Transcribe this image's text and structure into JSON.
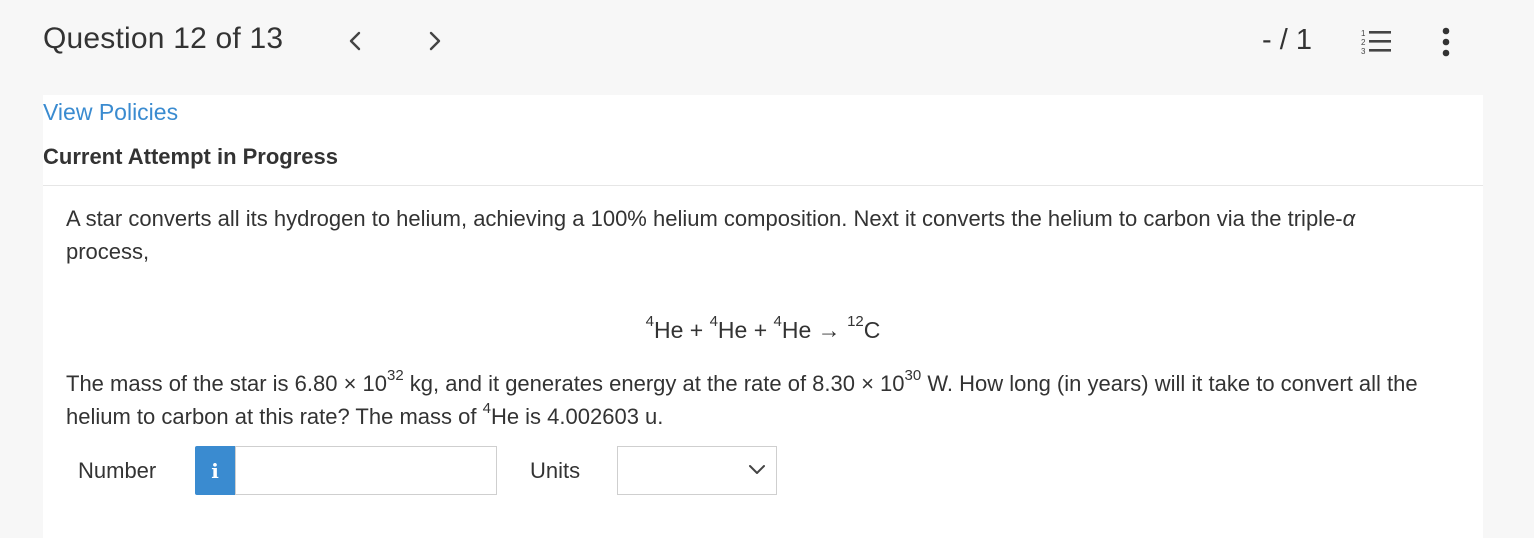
{
  "header": {
    "title": "Question 12 of 13",
    "score": "- / 1",
    "icons": [
      "chevron-left-icon",
      "chevron-right-icon",
      "numbered-list-icon",
      "more-vertical-icon"
    ]
  },
  "links": {
    "view_policies": "View Policies"
  },
  "status": {
    "attempt": "Current Attempt in Progress"
  },
  "question": {
    "p1": "A star converts all its hydrogen to helium, achieving a 100% helium composition. Next it converts the helium to carbon via the triple-",
    "p1_alpha": "α",
    "p1_end": "process,",
    "equation": {
      "he_mass": "4",
      "he": "He",
      "plus": " + ",
      "arrow": " → ",
      "c_mass": "12",
      "c": "C"
    },
    "p2_a": "The mass of the star is 6.80 × 10",
    "p2_exp1": "32",
    "p2_b": " kg, and it generates energy at the rate of 8.30 × 10",
    "p2_exp2": "30",
    "p2_c": " W. How long (in years) will it take to convert all the helium to carbon at this rate? The mass of ",
    "p2_he_mass": "4",
    "p2_d": "He is 4.002603 u."
  },
  "answer": {
    "number_label": "Number",
    "info_label": "i",
    "number_value": "",
    "units_label": "Units",
    "units_value": ""
  },
  "colors": {
    "accent": "#3a8bd0",
    "background": "#f7f7f7",
    "panel": "#ffffff"
  }
}
